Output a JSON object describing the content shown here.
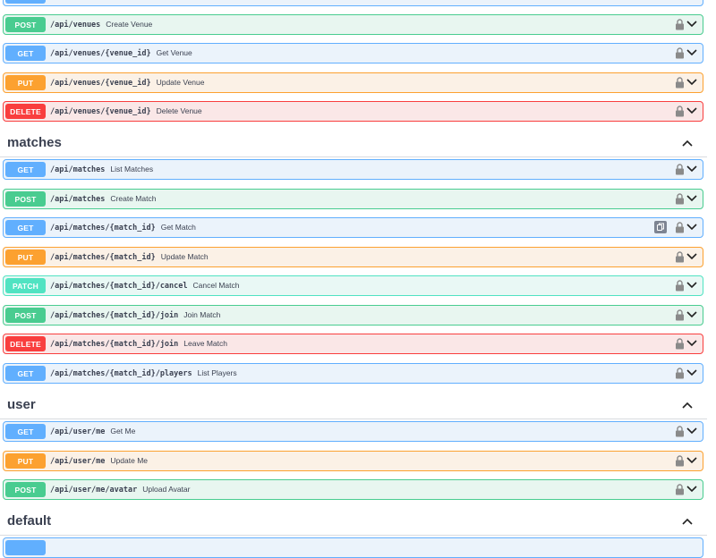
{
  "colors": {
    "get": "#61affe",
    "post": "#49cc90",
    "put": "#fca130",
    "delete": "#f93e3e",
    "patch": "#50e3c2",
    "text": "#3b4151"
  },
  "sections": [
    {
      "name": "matches"
    },
    {
      "name": "user"
    },
    {
      "name": "default"
    }
  ],
  "ops": [
    {
      "method": "POST",
      "path": "/api/venues",
      "summary": "Create Venue"
    },
    {
      "method": "GET",
      "path": "/api/venues/{venue_id}",
      "summary": "Get Venue"
    },
    {
      "method": "PUT",
      "path": "/api/venues/{venue_id}",
      "summary": "Update Venue"
    },
    {
      "method": "DELETE",
      "path": "/api/venues/{venue_id}",
      "summary": "Delete Venue"
    },
    {
      "method": "GET",
      "path": "/api/matches",
      "summary": "List Matches"
    },
    {
      "method": "POST",
      "path": "/api/matches",
      "summary": "Create Match"
    },
    {
      "method": "GET",
      "path": "/api/matches/{match_id}",
      "summary": "Get Match"
    },
    {
      "method": "PUT",
      "path": "/api/matches/{match_id}",
      "summary": "Update Match"
    },
    {
      "method": "PATCH",
      "path": "/api/matches/{match_id}/cancel",
      "summary": "Cancel Match"
    },
    {
      "method": "POST",
      "path": "/api/matches/{match_id}/join",
      "summary": "Join Match"
    },
    {
      "method": "DELETE",
      "path": "/api/matches/{match_id}/join",
      "summary": "Leave Match"
    },
    {
      "method": "GET",
      "path": "/api/matches/{match_id}/players",
      "summary": "List Players"
    },
    {
      "method": "GET",
      "path": "/api/user/me",
      "summary": "Get Me"
    },
    {
      "method": "PUT",
      "path": "/api/user/me",
      "summary": "Update Me"
    },
    {
      "method": "POST",
      "path": "/api/user/me/avatar",
      "summary": "Upload Avatar"
    }
  ],
  "icons": {
    "lock": "lock-icon",
    "expand": "chevron-down-icon",
    "collapse": "chevron-up-icon",
    "copy": "copy-icon"
  }
}
